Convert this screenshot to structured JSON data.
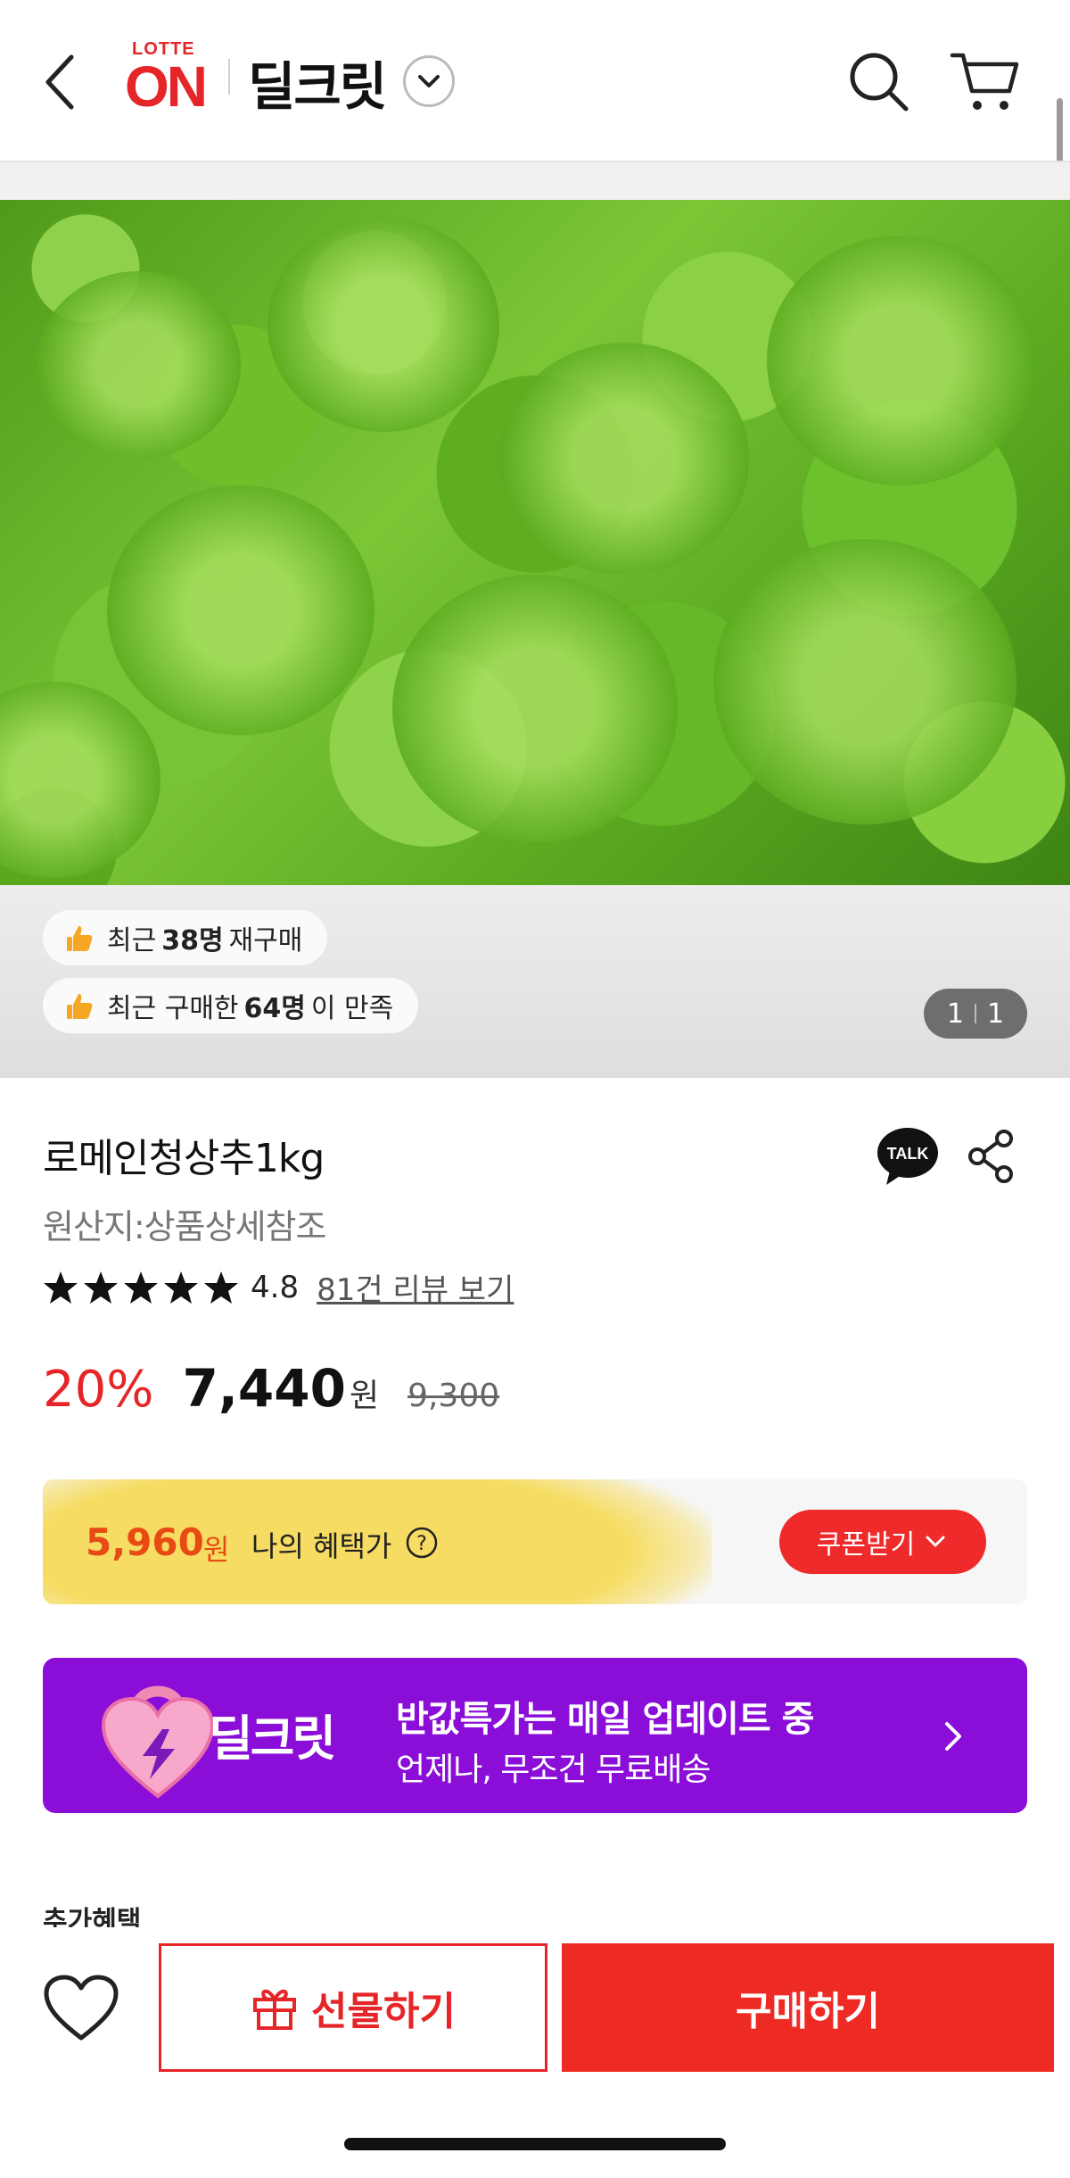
{
  "header": {
    "logo_top": "LOTTE",
    "logo_main": "ON",
    "brand_title": "딜크릿"
  },
  "gallery": {
    "badges": [
      {
        "prefix": "최근",
        "count": "38명",
        "suffix": "재구매"
      },
      {
        "prefix": "최근 구매한",
        "count": "64명",
        "suffix": "이 만족"
      }
    ],
    "pager_current": "1",
    "pager_total": "1"
  },
  "product": {
    "name": "로메인청상추1kg",
    "origin": "원산지:상품상세참조",
    "rating": 4.8,
    "rating_text": "4.8",
    "review_link": "81건 리뷰 보기",
    "discount": "20%",
    "price": "7,440",
    "currency": "원",
    "original_price": "9,300"
  },
  "benefit": {
    "price": "5,960",
    "currency": "원",
    "label": "나의 혜택가",
    "coupon_button": "쿠폰받기"
  },
  "promo": {
    "logo_text": "딜크릿",
    "title": "반값특가는 매일 업데이트 중",
    "subtitle": "언제나, 무조건 무료배송"
  },
  "extra_benefit_label": "추가혜택",
  "bottom_bar": {
    "gift_label": "선물하기",
    "buy_label": "구매하기"
  },
  "colors": {
    "accent_red": "#e52528",
    "promo_purple": "#8a0ed8",
    "benefit_orange": "#e84a14"
  }
}
